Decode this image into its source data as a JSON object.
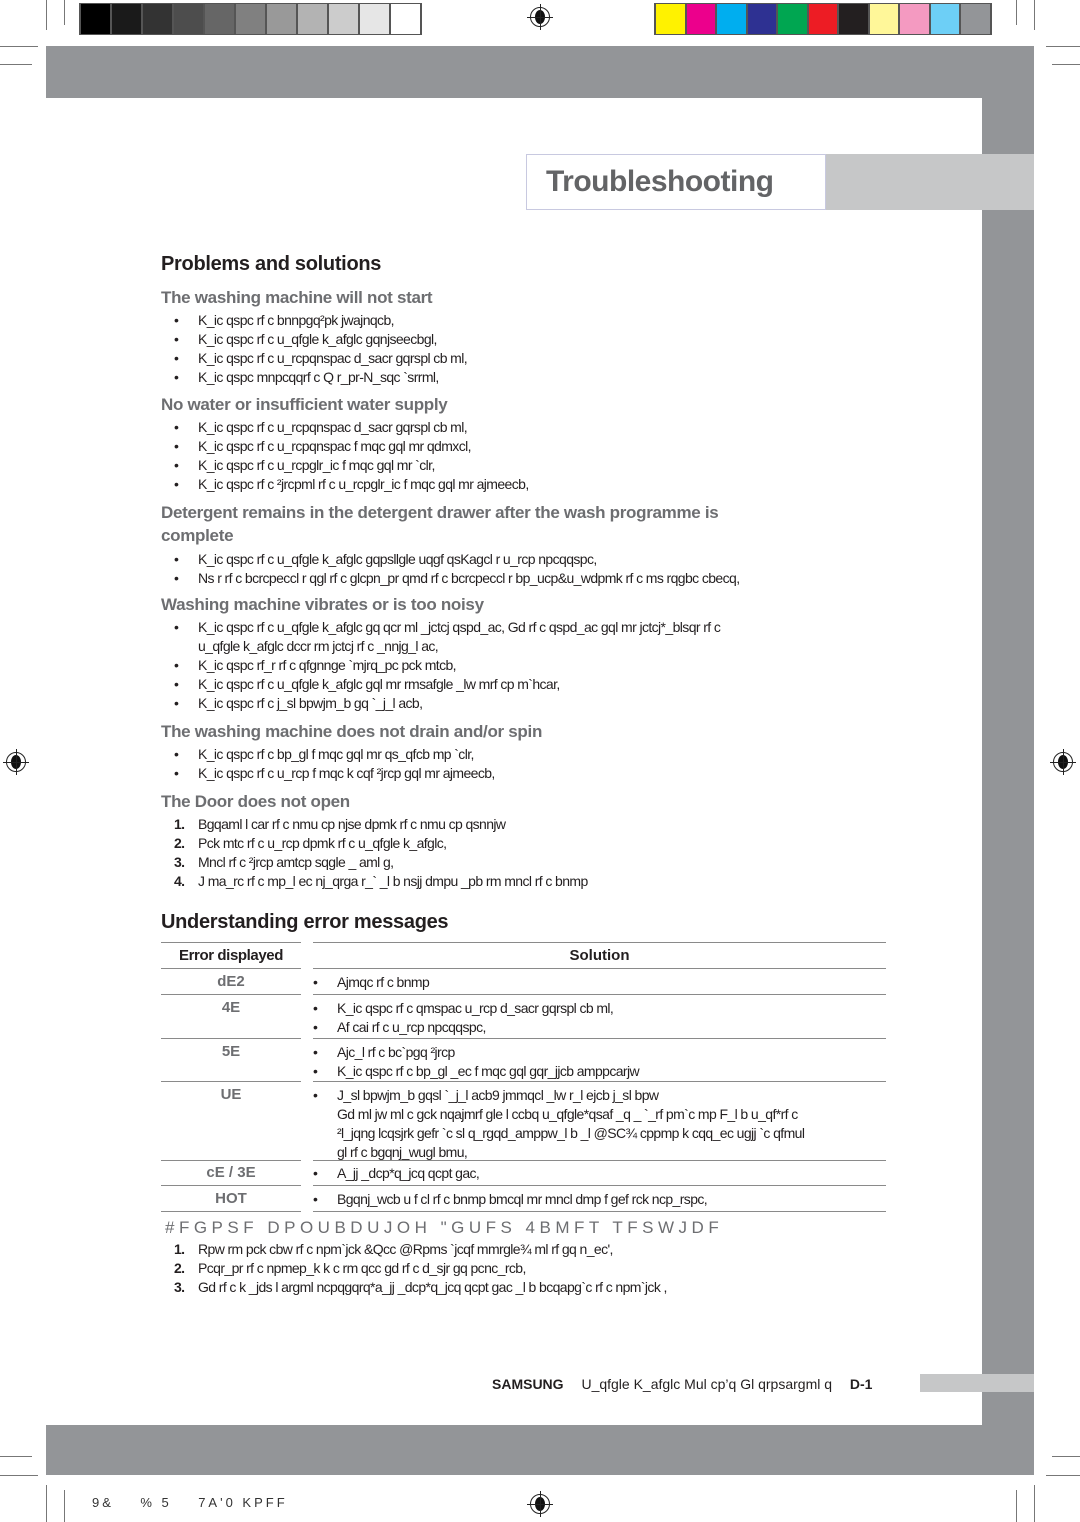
{
  "print_marks": {
    "gray_swatches": [
      "#000000",
      "#1a1a1a",
      "#333333",
      "#4d4d4d",
      "#666666",
      "#808080",
      "#999999",
      "#b3b3b3",
      "#cccccc",
      "#e6e6e6",
      "#ffffff"
    ],
    "color_swatches": [
      "#fff200",
      "#ec008c",
      "#00aeef",
      "#2e3192",
      "#00a651",
      "#ed1c24",
      "#231f20",
      "#fff799",
      "#f49ac1",
      "#6dcff6",
      "#939598"
    ],
    "slug": "9&    % 5    7A'0 KPFF"
  },
  "colors": {
    "band_gray": "#939598",
    "light_gray": "#c6c7c8",
    "subheading_gray": "#6d6e71",
    "title_gray": "#636466"
  },
  "header": {
    "title": "Troubleshooting"
  },
  "problems": {
    "title": "Problems and solutions",
    "sections": [
      {
        "heading": "The washing machine will not start",
        "items": [
          "K_ic qspc rf c bnnpgq²pk jwajnqcb,",
          "K_ic qspc rf c u_qfgle k_afglc gqnjseecbgl,",
          "K_ic qspc rf c u_rcpqnspac d_sacr gqrspl cb ml,",
          "K_ic qspc mnpcqqrf c Q r_pr-N_sqc  `srrml,"
        ]
      },
      {
        "heading": "No water or insufficient water supply",
        "items": [
          "K_ic qspc rf c u_rcpqnspac d_sacr gqrspl cb ml,",
          "K_ic qspc rf c u_rcpqnspac f mqc gql mr qdmxcl,",
          "K_ic qspc rf c u_rcpglr_ic f mqc gql mr `clr,",
          "K_ic qspc rf c ²jrcpml rf c u_rcpglr_ic f mqc gql mr ajmeecb,"
        ]
      },
      {
        "heading_line1": "Detergent remains in the detergent drawer after the wash programme is",
        "heading_line2": "complete",
        "items": [
          "K_ic qspc rf c u_qfgle k_afglc gqpsllgle uqgf qsKagcl r u_rcp npcqqspc,",
          "Ns r rf c bcrcpeccl r qgl rf c glcpn_pr qmd rf c bcrcpeccl r bp_ucp&u_wdpmk rf c ms rqgbc cbecq,"
        ]
      },
      {
        "heading": "Washing machine vibrates or is too noisy",
        "items": [
          "K_ic qspc rf c u_qfgle k_afglc gq qcr ml _jctcj qspd_ac, Gd rf c qspd_ac gql mr jctcj*_blsqr rf c",
          "K_ic qspc rf_r rf c qfgnnge `mjrq_pc pck mtcb,",
          "K_ic qspc rf c u_qfgle k_afglc gql mr rmsafgle _lw mrf cp m`hcar,",
          "K_ic qspc rf c j_sl bpwjm_b gq `_j_l acb,"
        ],
        "continuation_of_first": "u_qfgle k_afglc dccr rm jctcj rf c _nnjg_l ac,"
      },
      {
        "heading": "The washing machine does not drain and/or spin",
        "items": [
          "K_ic qspc rf c bp_gl f mqc gql mr qs_qfcb mp `clr,",
          "K_ic qspc rf c u_rcp f mqc k cqf ²jrcp gql mr ajmeecb,"
        ]
      },
      {
        "heading": "The Door does not open",
        "numbered": [
          {
            "num": "1.",
            "text": "Bgqaml l car rf c nmu cp njse dpmk  rf c nmu cp qsnnjw"
          },
          {
            "num": "2.",
            "text": "Pck mtc rf c u_rcp dpmk  rf c u_qfgle k_afglc,"
          },
          {
            "num": "3.",
            "text": "Mncl rf c ²jrcp amtcp sqgle _ aml g,"
          },
          {
            "num": "4.",
            "text": "J ma_rc rf c mp_l ec nj_qrga r_` _l b nsjj dmpu _pb rm mncl rf c bnmp"
          }
        ]
      }
    ]
  },
  "errors": {
    "title": "Understanding error messages",
    "col_error": "Error displayed",
    "col_solution": "Solution",
    "rows": [
      {
        "code": "dE2",
        "items": [
          "Ajmqc rf c bnmp"
        ]
      },
      {
        "code": "4E",
        "items": [
          "K_ic qspc rf c qmspac u_rcp d_sacr gqrspl cb ml,",
          "Af cai rf c u_rcp npcqqspc,"
        ]
      },
      {
        "code": "5E",
        "items": [
          "Ajc_l rf c bc`pgq ²jrcp",
          "K_ic qspc rf c bp_gl _ec f mqc gql gqr_jjcb amppcarjw"
        ]
      },
      {
        "code": "UE",
        "items": [
          "J_sl bpwjm_b gqsl `_j_l acb9 jmmqcl _lw r_l ejcb j_sl bpw"
        ],
        "continuation": [
          "Gd ml jw ml c gck nqajmrf gle l ccbq u_qfgle*qsaf _q _ `_rf pm`c mp F_l b u_qf*rf c",
          "²l_jqng lcqsjrk gefr `c sl q_rgqd_amppw_l b _l  @SC¾ cppmp k cqq_ec ugjj `c qfmul",
          "gl rf c bgqnj_wugl bmu,"
        ]
      },
      {
        "code": "cE / 3E",
        "items": [
          "A_jj _dcp*q_jcq qcpt gac,"
        ]
      },
      {
        "code": "HOT",
        "items": [
          "Bgqnj_wcb u f cl rf c bnmp bmcql mr mncl  dmp f gef rck ncp_rspc,"
        ]
      }
    ]
  },
  "before_contacting": {
    "heading": "#FGPSF DPOUBDUJOH \"GUFS 4BMFT TFSWJDF",
    "numbered": [
      {
        "num": "1.",
        "text": "Rpw rm pck cbw rf c npm`jck  &Qcc @Rpms `jcqf mmrgle¾ ml rf gq n_ec',"
      },
      {
        "num": "2.",
        "text": "Pcqr_pr rf c npmep_k k c rm qcc gd rf c d_sjr gq pcnc_rcb,"
      },
      {
        "num": "3.",
        "text": "Gd rf c k _jds l argml ncpqgqrq*a_jj _dcp*q_jcq qcpt gac _l b bcqapg`c rf c npm`jck ,"
      }
    ]
  },
  "footer": {
    "brand": "SAMSUNG",
    "text": "U_qfgle K_afglc Mul cp’q Gl qrpsargml q",
    "page": "D-1"
  }
}
